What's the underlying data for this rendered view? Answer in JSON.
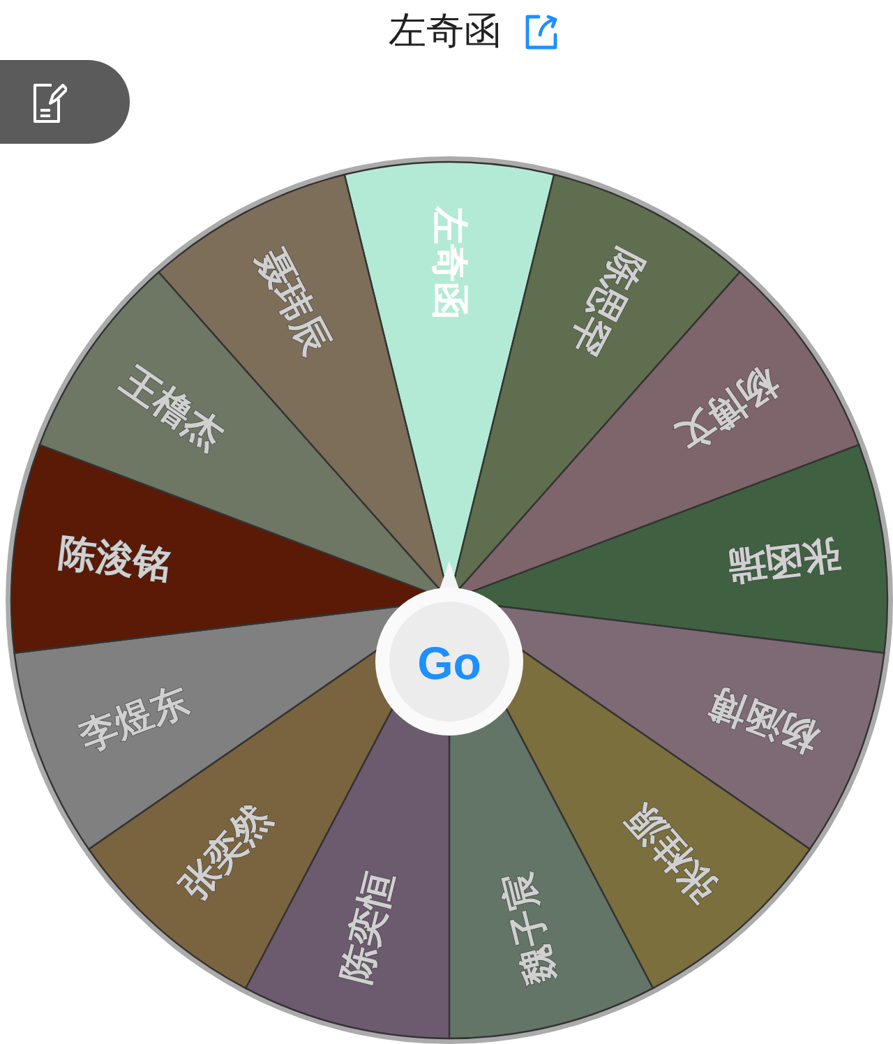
{
  "title": "左奇函",
  "segments": [
    {
      "name": "左奇函",
      "color": "#b2ead6",
      "selected": true
    },
    {
      "name": "陈思罕",
      "color": "#5f6e4f",
      "selected": false
    },
    {
      "name": "杨博文",
      "color": "#7e646b",
      "selected": false
    },
    {
      "name": "张函瑞",
      "color": "#3f6142",
      "selected": false
    },
    {
      "name": "杨涵博",
      "color": "#7d6a74",
      "selected": false
    },
    {
      "name": "张桂源",
      "color": "#7b6f3e",
      "selected": false
    },
    {
      "name": "魏子宸",
      "color": "#637566",
      "selected": false
    },
    {
      "name": "陈奕恒",
      "color": "#6c5a6e",
      "selected": false
    },
    {
      "name": "张奕然",
      "color": "#7a643f",
      "selected": false
    },
    {
      "name": "李煜东",
      "color": "#808080",
      "selected": false
    },
    {
      "name": "陈浚铭",
      "color": "#5a1a06",
      "selected": false
    },
    {
      "name": "王橹杰",
      "color": "#6e7664",
      "selected": false
    },
    {
      "name": "聂玮辰",
      "color": "#7d6e5a",
      "selected": false
    }
  ],
  "go_button": "Go"
}
